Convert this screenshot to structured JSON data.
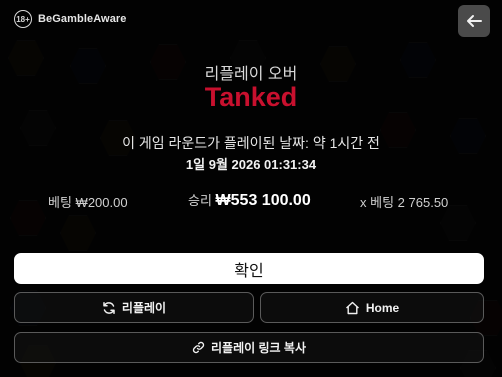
{
  "header": {
    "age_badge": "18+",
    "begambleaware": "BeGambleAware"
  },
  "replay": {
    "heading": "리플레이 오버",
    "status": "Tanked",
    "played_when": "이 게임 라운드가 플레이된 날짜: 약 1시간 전",
    "played_date": "1일 9월 2026 01:31:34"
  },
  "stats": {
    "bet_label": "베팅",
    "bet_value": "₩200.00",
    "win_label": "승리",
    "win_value": "₩553 100.00",
    "multiplier_label": "x 베팅",
    "multiplier_value": "2 765.50"
  },
  "buttons": {
    "confirm": "확인",
    "replay": "리플레이",
    "home": "Home",
    "copy_link": "리플레이 링크 복사"
  },
  "colors": {
    "status_red": "#c8102e",
    "confirm_bg": "#ffffff",
    "back_button_bg": "#4a4a4a"
  },
  "icons": [
    "back-arrow-icon",
    "refresh-icon",
    "home-icon",
    "link-icon"
  ]
}
